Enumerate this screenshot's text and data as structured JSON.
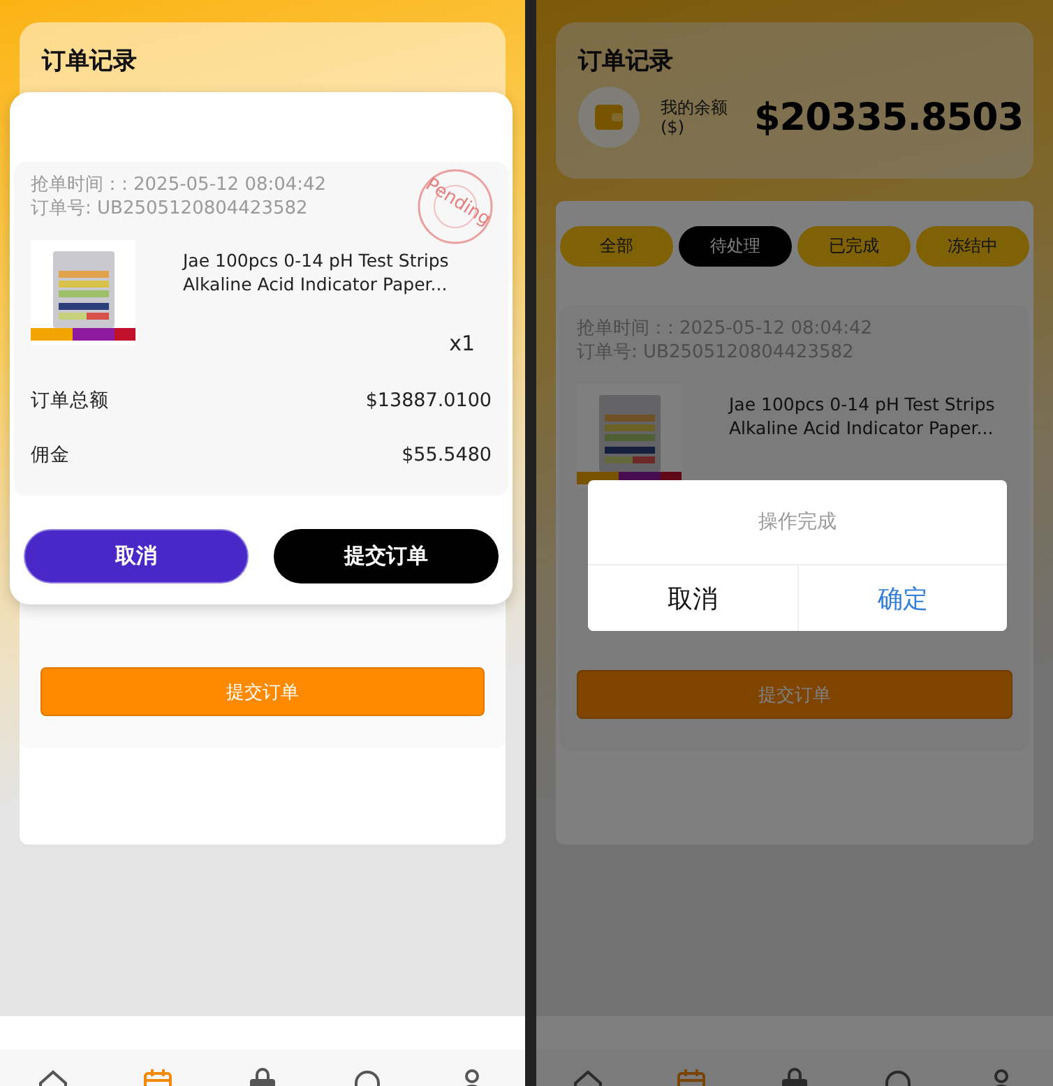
{
  "left_screen": {
    "header": {
      "title": "订单记录"
    },
    "order_popup": {
      "time": "抢单时间：: 2025-05-12 08:04:42",
      "number": "订单号: UB2505120804423582",
      "stamp": "Pending",
      "product_title": "Jae 100pcs 0-14 pH Test Strips Alkaline Acid Indicator Paper...",
      "quantity": "x1",
      "rows": [
        {
          "label": "订单总额",
          "value": "$13887.0100"
        },
        {
          "label": "佣金",
          "value": "$55.5480"
        }
      ],
      "cancel_button": "取消",
      "submit_button": "提交订单"
    },
    "submit_button": "提交订单",
    "nav": [
      {
        "selected": false
      },
      {
        "selected": true
      },
      {
        "selected": false
      },
      {
        "selected": false
      },
      {
        "selected": false
      }
    ]
  },
  "right_screen": {
    "header": {
      "title": "订单记录",
      "balance_label": "我的余额 ($)",
      "balance": "$20335.8503"
    },
    "tabs": [
      {
        "label": "全部",
        "selected": false
      },
      {
        "label": "待处理",
        "selected": true
      },
      {
        "label": "已完成",
        "selected": false
      },
      {
        "label": "冻结中",
        "selected": false
      }
    ],
    "order": {
      "time": "抢单时间：: 2025-05-12 08:04:42",
      "number": "订单号: UB2505120804423582",
      "product_title": "Jae 100pcs 0-14 pH Test Strips Alkaline Acid Indicator Paper..."
    },
    "submit_button": "提交订单",
    "dialog": {
      "message": "操作完成",
      "cancel_button": "取消",
      "confirm_button": "确定"
    },
    "nav": [
      {
        "selected": false
      },
      {
        "selected": true
      },
      {
        "selected": false
      },
      {
        "selected": false
      },
      {
        "selected": false
      }
    ]
  }
}
